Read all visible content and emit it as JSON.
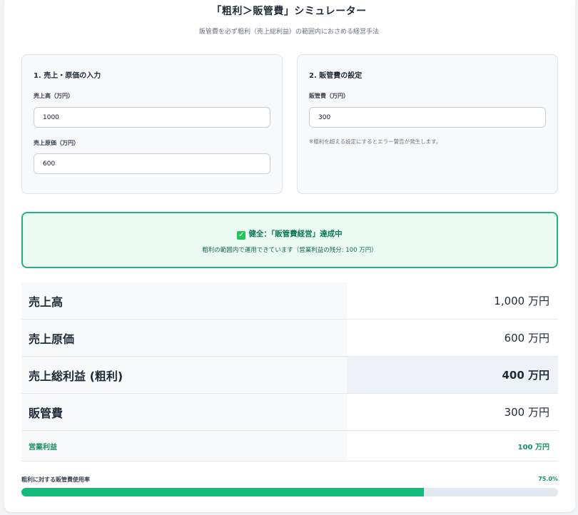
{
  "header": {
    "title": "「粗利＞販管費」シミュレーター",
    "subtitle": "販管費を必ず粗利（売上総利益）の範囲内におさめる経営手法"
  },
  "sales_panel": {
    "title": "1. 売上・原価の入力",
    "sales_label": "売上高（万円）",
    "sales_value": "1000",
    "cost_label": "売上原価（万円）",
    "cost_value": "600"
  },
  "sga_panel": {
    "title": "2. 販管費の設定",
    "sga_label": "販管費（万円）",
    "sga_value": "300",
    "note": "※粗利を超える設定にするとエラー警告が発生します。"
  },
  "status": {
    "title": "健全：「販管費経営」達成中",
    "message": "粗利の範囲内で運用できています（営業利益の残分: 100 万円）",
    "check_icon": "✓"
  },
  "summary": {
    "rows": [
      {
        "label": "売上高",
        "value": "1,000 万円"
      },
      {
        "label": "売上原価",
        "value": "600 万円"
      },
      {
        "label": "売上総利益 (粗利)",
        "value": "400 万円"
      },
      {
        "label": "販管費",
        "value": "300 万円"
      },
      {
        "label": "営業利益",
        "value": "100 万円"
      }
    ]
  },
  "ratio": {
    "label": "粗利に対する販管費使用率",
    "value_text": "75.0%",
    "fraction": 0.75
  },
  "colors": {
    "accent": "#16b97c",
    "status_border": "#1fb57a",
    "status_bg": "#ebfaf2"
  }
}
